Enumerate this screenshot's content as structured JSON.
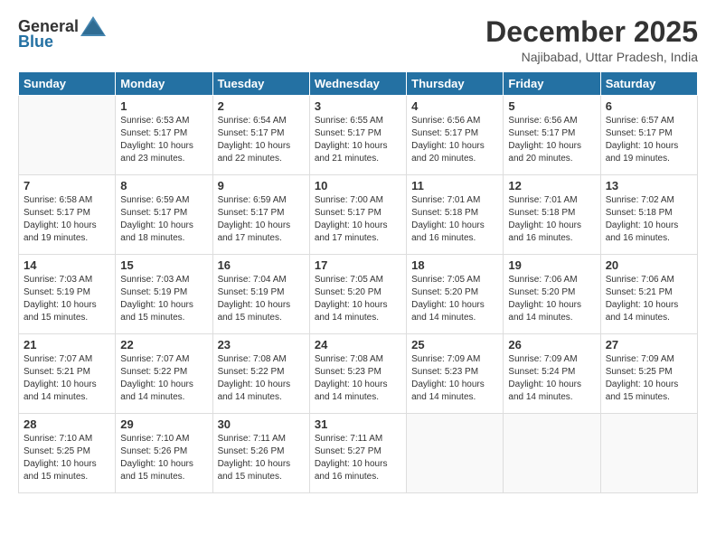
{
  "logo": {
    "general": "General",
    "blue": "Blue"
  },
  "title": "December 2025",
  "location": "Najibabad, Uttar Pradesh, India",
  "days_header": [
    "Sunday",
    "Monday",
    "Tuesday",
    "Wednesday",
    "Thursday",
    "Friday",
    "Saturday"
  ],
  "weeks": [
    [
      {
        "day": "",
        "info": ""
      },
      {
        "day": "1",
        "info": "Sunrise: 6:53 AM\nSunset: 5:17 PM\nDaylight: 10 hours\nand 23 minutes."
      },
      {
        "day": "2",
        "info": "Sunrise: 6:54 AM\nSunset: 5:17 PM\nDaylight: 10 hours\nand 22 minutes."
      },
      {
        "day": "3",
        "info": "Sunrise: 6:55 AM\nSunset: 5:17 PM\nDaylight: 10 hours\nand 21 minutes."
      },
      {
        "day": "4",
        "info": "Sunrise: 6:56 AM\nSunset: 5:17 PM\nDaylight: 10 hours\nand 20 minutes."
      },
      {
        "day": "5",
        "info": "Sunrise: 6:56 AM\nSunset: 5:17 PM\nDaylight: 10 hours\nand 20 minutes."
      },
      {
        "day": "6",
        "info": "Sunrise: 6:57 AM\nSunset: 5:17 PM\nDaylight: 10 hours\nand 19 minutes."
      }
    ],
    [
      {
        "day": "7",
        "info": "Sunrise: 6:58 AM\nSunset: 5:17 PM\nDaylight: 10 hours\nand 19 minutes."
      },
      {
        "day": "8",
        "info": "Sunrise: 6:59 AM\nSunset: 5:17 PM\nDaylight: 10 hours\nand 18 minutes."
      },
      {
        "day": "9",
        "info": "Sunrise: 6:59 AM\nSunset: 5:17 PM\nDaylight: 10 hours\nand 17 minutes."
      },
      {
        "day": "10",
        "info": "Sunrise: 7:00 AM\nSunset: 5:17 PM\nDaylight: 10 hours\nand 17 minutes."
      },
      {
        "day": "11",
        "info": "Sunrise: 7:01 AM\nSunset: 5:18 PM\nDaylight: 10 hours\nand 16 minutes."
      },
      {
        "day": "12",
        "info": "Sunrise: 7:01 AM\nSunset: 5:18 PM\nDaylight: 10 hours\nand 16 minutes."
      },
      {
        "day": "13",
        "info": "Sunrise: 7:02 AM\nSunset: 5:18 PM\nDaylight: 10 hours\nand 16 minutes."
      }
    ],
    [
      {
        "day": "14",
        "info": "Sunrise: 7:03 AM\nSunset: 5:19 PM\nDaylight: 10 hours\nand 15 minutes."
      },
      {
        "day": "15",
        "info": "Sunrise: 7:03 AM\nSunset: 5:19 PM\nDaylight: 10 hours\nand 15 minutes."
      },
      {
        "day": "16",
        "info": "Sunrise: 7:04 AM\nSunset: 5:19 PM\nDaylight: 10 hours\nand 15 minutes."
      },
      {
        "day": "17",
        "info": "Sunrise: 7:05 AM\nSunset: 5:20 PM\nDaylight: 10 hours\nand 14 minutes."
      },
      {
        "day": "18",
        "info": "Sunrise: 7:05 AM\nSunset: 5:20 PM\nDaylight: 10 hours\nand 14 minutes."
      },
      {
        "day": "19",
        "info": "Sunrise: 7:06 AM\nSunset: 5:20 PM\nDaylight: 10 hours\nand 14 minutes."
      },
      {
        "day": "20",
        "info": "Sunrise: 7:06 AM\nSunset: 5:21 PM\nDaylight: 10 hours\nand 14 minutes."
      }
    ],
    [
      {
        "day": "21",
        "info": "Sunrise: 7:07 AM\nSunset: 5:21 PM\nDaylight: 10 hours\nand 14 minutes."
      },
      {
        "day": "22",
        "info": "Sunrise: 7:07 AM\nSunset: 5:22 PM\nDaylight: 10 hours\nand 14 minutes."
      },
      {
        "day": "23",
        "info": "Sunrise: 7:08 AM\nSunset: 5:22 PM\nDaylight: 10 hours\nand 14 minutes."
      },
      {
        "day": "24",
        "info": "Sunrise: 7:08 AM\nSunset: 5:23 PM\nDaylight: 10 hours\nand 14 minutes."
      },
      {
        "day": "25",
        "info": "Sunrise: 7:09 AM\nSunset: 5:23 PM\nDaylight: 10 hours\nand 14 minutes."
      },
      {
        "day": "26",
        "info": "Sunrise: 7:09 AM\nSunset: 5:24 PM\nDaylight: 10 hours\nand 14 minutes."
      },
      {
        "day": "27",
        "info": "Sunrise: 7:09 AM\nSunset: 5:25 PM\nDaylight: 10 hours\nand 15 minutes."
      }
    ],
    [
      {
        "day": "28",
        "info": "Sunrise: 7:10 AM\nSunset: 5:25 PM\nDaylight: 10 hours\nand 15 minutes."
      },
      {
        "day": "29",
        "info": "Sunrise: 7:10 AM\nSunset: 5:26 PM\nDaylight: 10 hours\nand 15 minutes."
      },
      {
        "day": "30",
        "info": "Sunrise: 7:11 AM\nSunset: 5:26 PM\nDaylight: 10 hours\nand 15 minutes."
      },
      {
        "day": "31",
        "info": "Sunrise: 7:11 AM\nSunset: 5:27 PM\nDaylight: 10 hours\nand 16 minutes."
      },
      {
        "day": "",
        "info": ""
      },
      {
        "day": "",
        "info": ""
      },
      {
        "day": "",
        "info": ""
      }
    ]
  ]
}
